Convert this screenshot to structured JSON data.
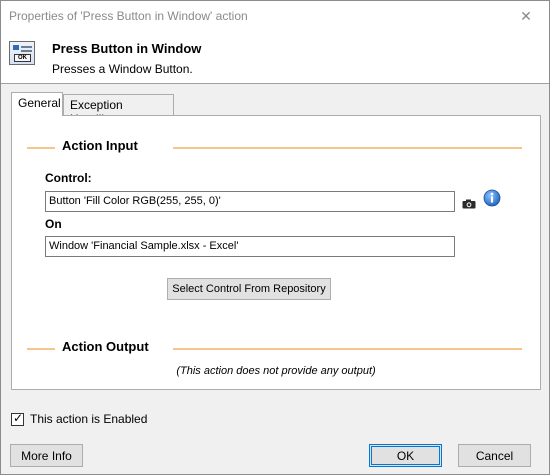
{
  "window": {
    "title": "Properties of 'Press Button in Window' action",
    "close_glyph": "✕"
  },
  "header": {
    "icon": "press-button-action-icon",
    "icon_text": "OK",
    "title": "Press Button in Window",
    "description": "Presses a Window Button."
  },
  "tabs": [
    {
      "label": "General",
      "active": true
    },
    {
      "label": "Exception Handling",
      "active": false
    }
  ],
  "action_input": {
    "heading": "Action Input",
    "control_label": "Control:",
    "control_value": "Button 'Fill Color RGB(255, 255, 0)'",
    "on_label": "On",
    "on_value": "Window 'Financial Sample.xlsx - Excel'",
    "camera_icon": "camera-icon",
    "info_icon": "info-icon",
    "repository_button": "Select Control From Repository"
  },
  "action_output": {
    "heading": "Action Output",
    "note": "(This action does not provide any output)"
  },
  "enabled": {
    "checked": true,
    "label": "This action is Enabled"
  },
  "footer": {
    "more_info": "More Info",
    "ok": "OK",
    "cancel": "Cancel"
  },
  "colors": {
    "section_line": "#f7c58a",
    "ok_border": "#0078d7",
    "info_blue": "#2a6fc9"
  }
}
